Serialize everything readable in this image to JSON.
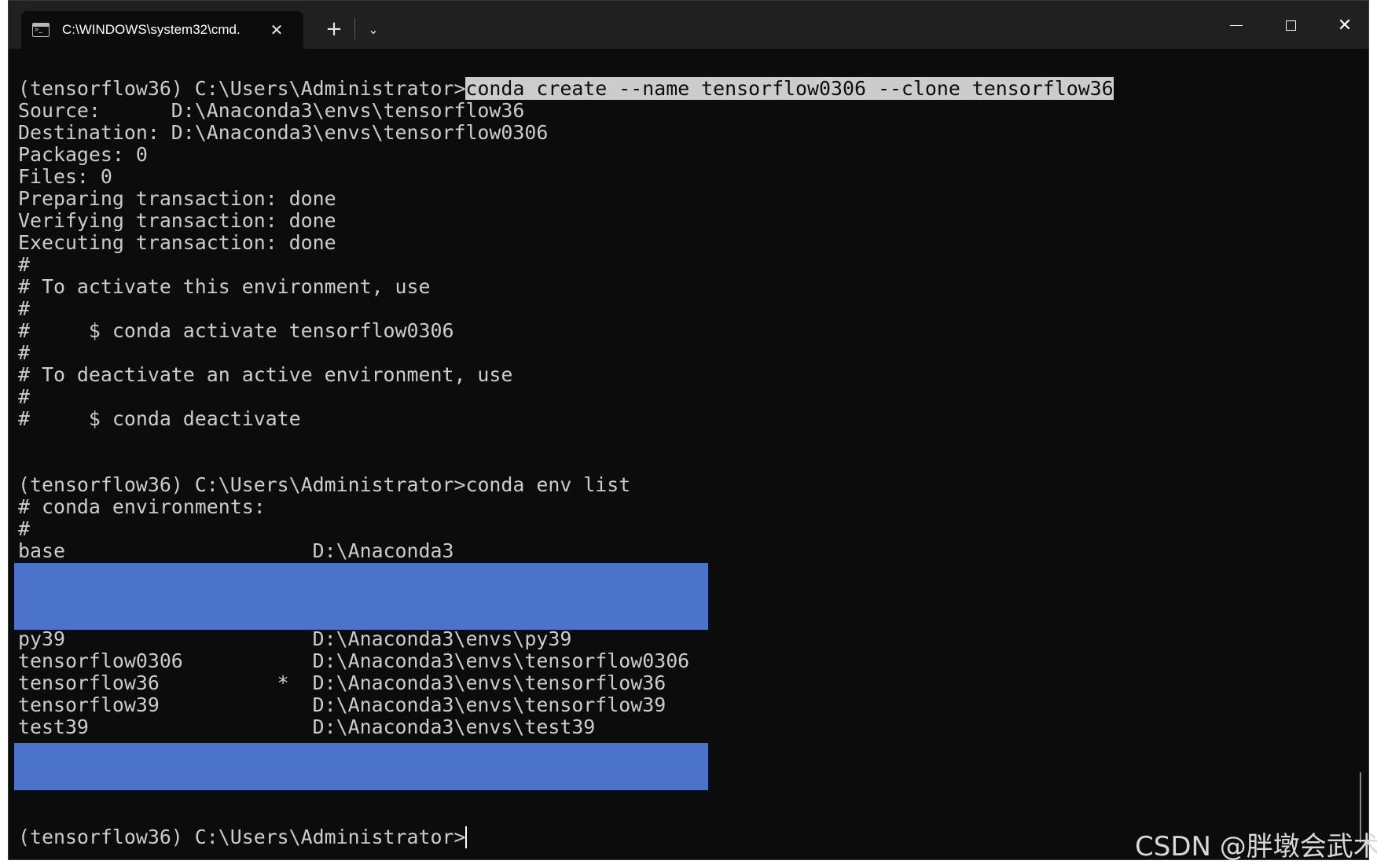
{
  "window": {
    "tab_title": "C:\\WINDOWS\\system32\\cmd.",
    "tab_close_glyph": "✕",
    "new_tab_glyph": "+",
    "dropdown_glyph": "⌄",
    "close_glyph": "✕",
    "icons": [
      "terminal-icon",
      "close-icon",
      "plus-icon",
      "chevron-down-icon",
      "minimize-icon",
      "maximize-icon",
      "close-window-icon"
    ]
  },
  "colors": {
    "terminal_bg": "#0c0c0c",
    "text": "#cccccc",
    "selection_bg": "#cccccc",
    "redaction": "#4a73c9",
    "titlebar": "#202020"
  },
  "console": {
    "prompt1": "(tensorflow36) C:\\Users\\Administrator>",
    "cmd1": "conda create --name tensorflow0306 --clone tensorflow36",
    "output1": [
      "Source:      D:\\Anaconda3\\envs\\tensorflow36",
      "Destination: D:\\Anaconda3\\envs\\tensorflow0306",
      "Packages: 0",
      "Files: 0",
      "Preparing transaction: done",
      "Verifying transaction: done",
      "Executing transaction: done",
      "#",
      "# To activate this environment, use",
      "#",
      "#     $ conda activate tensorflow0306",
      "#",
      "# To deactivate an active environment, use",
      "#",
      "#     $ conda deactivate"
    ],
    "prompt2": "(tensorflow36) C:\\Users\\Administrator>",
    "cmd2": "conda env list",
    "output2": [
      "# conda environments:",
      "#",
      "base                     D:\\Anaconda3"
    ],
    "output3": [
      "py39                     D:\\Anaconda3\\envs\\py39",
      "tensorflow0306           D:\\Anaconda3\\envs\\tensorflow0306",
      "tensorflow36          *  D:\\Anaconda3\\envs\\tensorflow36",
      "tensorflow39             D:\\Anaconda3\\envs\\tensorflow39",
      "test39                   D:\\Anaconda3\\envs\\test39"
    ],
    "prompt3": "(tensorflow36) C:\\Users\\Administrator>"
  },
  "watermark": "CSDN @胖墩会武术"
}
